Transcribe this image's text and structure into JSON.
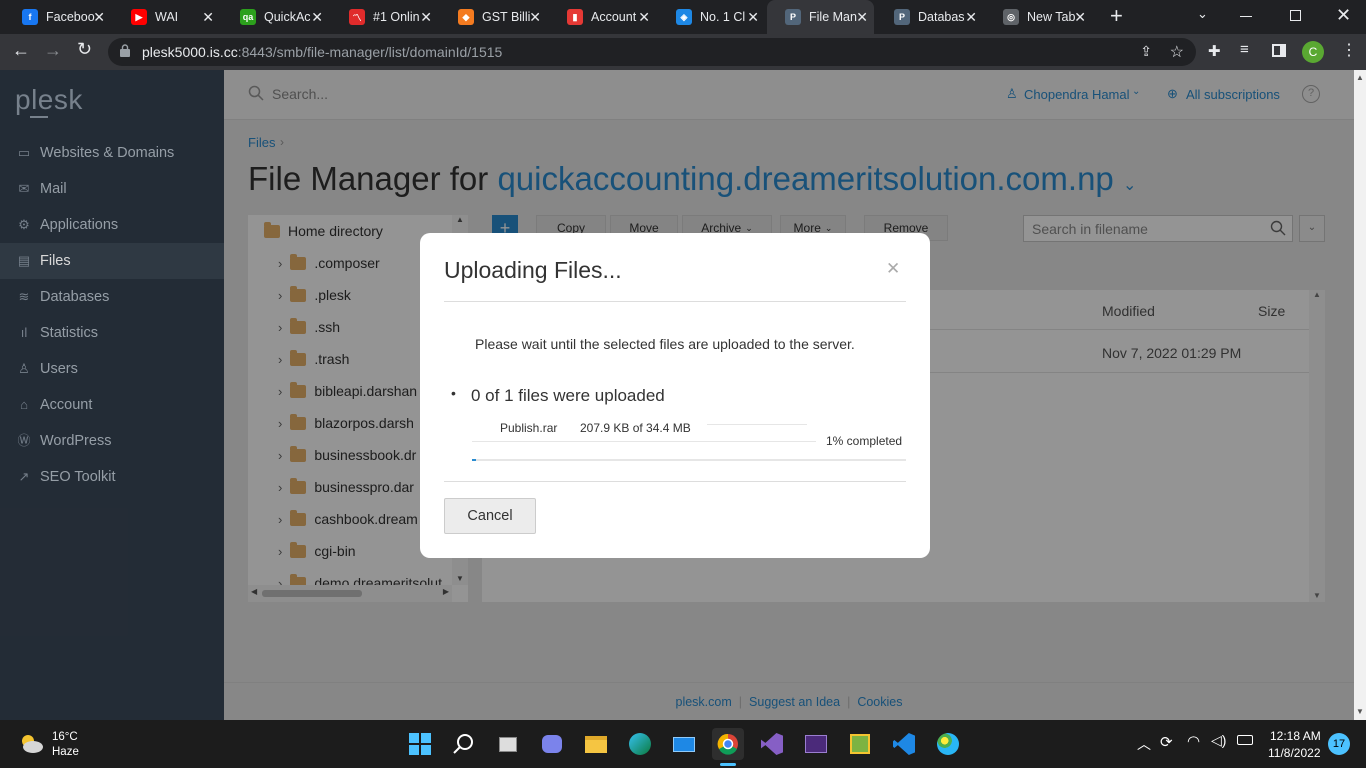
{
  "browser": {
    "tabs": [
      {
        "title": "Faceboo",
        "icon": "facebook-icon",
        "color": "#1877f2",
        "glyph": "f"
      },
      {
        "title": "WAI",
        "icon": "youtube-icon",
        "color": "#ff0000",
        "glyph": "▶"
      },
      {
        "title": "QuickAc",
        "icon": "quickaccounting-icon",
        "color": "#2ca01c",
        "glyph": "qa"
      },
      {
        "title": "#1 Onlin",
        "icon": "online-icon",
        "color": "#e02b2b",
        "glyph": "〽"
      },
      {
        "title": "GST Billi",
        "icon": "gst-icon",
        "color": "#f47b20",
        "glyph": "◆"
      },
      {
        "title": "Account",
        "icon": "bookmark-icon",
        "color": "#e53935",
        "glyph": "▮"
      },
      {
        "title": "No. 1 Cl",
        "icon": "diamond-icon",
        "color": "#1e88e5",
        "glyph": "◈"
      },
      {
        "title": "File Man",
        "icon": "plesk-icon",
        "color": "#52667a",
        "glyph": "P"
      },
      {
        "title": "Databas",
        "icon": "plesk-icon",
        "color": "#52667a",
        "glyph": "P"
      },
      {
        "title": "New Tab",
        "icon": "chrome-icon",
        "color": "#5f6368",
        "glyph": "◎"
      }
    ],
    "url_host": "plesk5000.is.cc",
    "url_path": ":8443/smb/file-manager/list/domainId/1515",
    "profile_initial": "C"
  },
  "sidebar": {
    "logo": "plesk",
    "items": [
      {
        "label": "Websites & Domains",
        "icon": "monitor-icon",
        "glyph": "▭"
      },
      {
        "label": "Mail",
        "icon": "mail-icon",
        "glyph": "✉"
      },
      {
        "label": "Applications",
        "icon": "gear-icon",
        "glyph": "⚙"
      },
      {
        "label": "Files",
        "icon": "files-icon",
        "glyph": "▤"
      },
      {
        "label": "Databases",
        "icon": "database-icon",
        "glyph": "≋"
      },
      {
        "label": "Statistics",
        "icon": "chart-icon",
        "glyph": "ıl"
      },
      {
        "label": "Users",
        "icon": "user-icon",
        "glyph": "♙"
      },
      {
        "label": "Account",
        "icon": "account-icon",
        "glyph": "⌂"
      },
      {
        "label": "WordPress",
        "icon": "wordpress-icon",
        "glyph": "Ⓦ"
      },
      {
        "label": "SEO Toolkit",
        "icon": "seo-icon",
        "glyph": "↗"
      }
    ],
    "active_index": 3
  },
  "header": {
    "search_placeholder": "Search...",
    "user": "Chopendra Hamal",
    "subscriptions": "All subscriptions"
  },
  "page": {
    "breadcrumb": "Files",
    "title_prefix": "File Manager for",
    "domain": "quickaccounting.dreameritsolution.com.np"
  },
  "toolbar": {
    "buttons": [
      "Copy",
      "Move",
      "Archive",
      "More",
      "Remove"
    ],
    "search_placeholder": "Search in filename"
  },
  "tree": {
    "root": "Home directory",
    "items": [
      ".composer",
      ".plesk",
      ".ssh",
      ".trash",
      "bibleapi.darshan",
      "blazorpos.darsh",
      "businessbook.dr",
      "businesspro.dar",
      "cashbook.dream",
      "cgi-bin",
      "demo.dreameritsolut"
    ]
  },
  "table": {
    "columns": {
      "modified": "Modified",
      "size": "Size"
    },
    "rows": [
      {
        "modified": "Nov 7, 2022 01:29 PM"
      }
    ]
  },
  "modal": {
    "title": "Uploading Files...",
    "message": "Please wait until the selected files are uploaded to the server.",
    "summary": "0 of 1 files were uploaded",
    "file_name": "Publish.rar",
    "file_progress_text": "207.9 KB of 34.4 MB",
    "completed_text": "1% completed",
    "progress_fraction": 0.01,
    "cancel_label": "Cancel"
  },
  "footer": {
    "links": [
      "plesk.com",
      "Suggest an Idea",
      "Cookies"
    ]
  },
  "taskbar": {
    "weather_temp": "16°C",
    "weather_desc": "Haze",
    "time": "12:18 AM",
    "date": "11/8/2022",
    "notification_count": "17"
  }
}
